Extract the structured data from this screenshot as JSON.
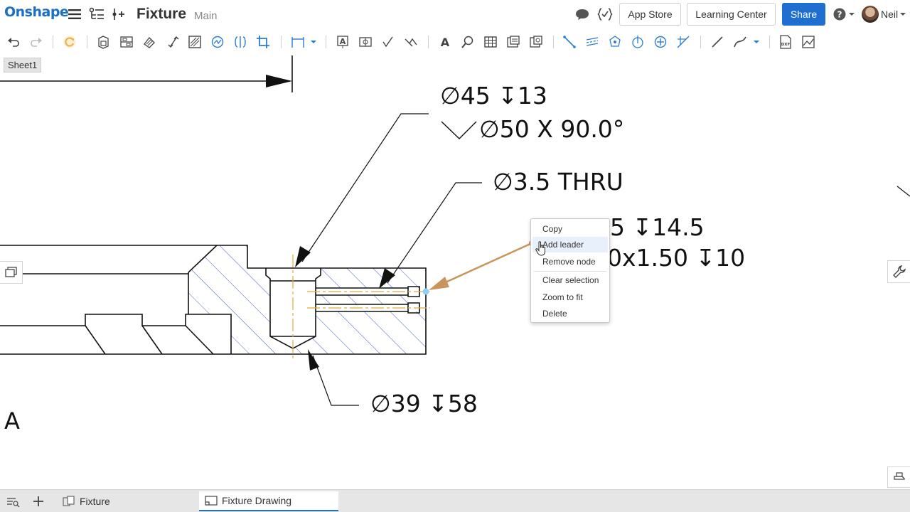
{
  "header": {
    "logo": "Onshape",
    "doc_title": "Fixture",
    "branch": "Main",
    "buttons": {
      "app_store": "App Store",
      "learning_center": "Learning Center",
      "share": "Share"
    },
    "user": "Neil"
  },
  "sheet": {
    "name": "Sheet1"
  },
  "callouts": {
    "c1_line1": "∅45 ↧13",
    "c1_line2": "∅50 X 90.0°",
    "c2": "∅3.5 THRU",
    "c3_line1": "5 ↧14.5",
    "c3_line2": "0x1.50 ↧10",
    "c4": "∅39 ↧58",
    "view_label": "A"
  },
  "context_menu": {
    "items": [
      "Copy",
      "Add leader",
      "Remove node",
      "Clear selection",
      "Zoom to fit",
      "Delete"
    ],
    "highlighted": "Add leader"
  },
  "tabs": [
    {
      "label": "Fixture",
      "active": false
    },
    {
      "label": "Fixture Drawing",
      "active": true
    }
  ],
  "colors": {
    "accent": "#1f6fd0",
    "hatch": "#3a5fc8",
    "leader": "#c8955a",
    "centerline": "#e5a83a"
  },
  "icons": {
    "toolbar": [
      "undo-icon",
      "redo-icon",
      "regenerate-icon",
      "insert-view-icon",
      "projected-view-icon",
      "auxiliary-view-icon",
      "detail-view-icon",
      "section-view-icon",
      "broken-view-icon",
      "crop-view-icon",
      "dimension-icon",
      "note-icon",
      "callout-icon",
      "surface-finish-icon",
      "weld-icon",
      "text-icon",
      "inspect-icon",
      "table-icon",
      "bom-icon",
      "hole-table-icon",
      "line-icon",
      "centerline-icon",
      "centermark-icon",
      "bolt-circle-icon",
      "point-icon",
      "leader-icon",
      "sketch-line-icon",
      "spline-icon",
      "export-dxf-icon",
      "image-icon"
    ]
  }
}
